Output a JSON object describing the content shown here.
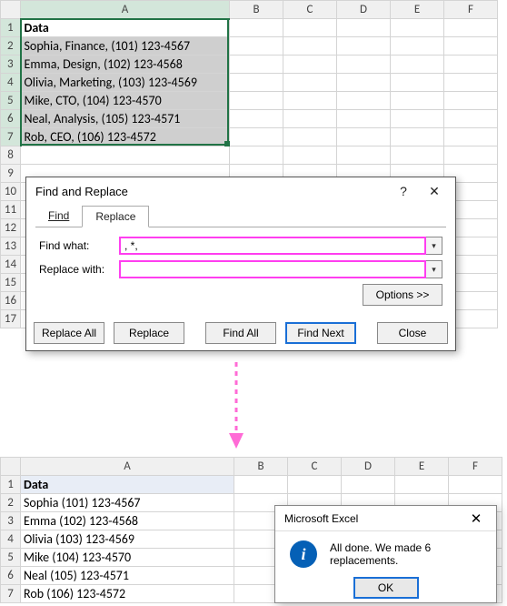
{
  "top_sheet": {
    "columns": [
      "A",
      "B",
      "C",
      "D",
      "E",
      "F"
    ],
    "rows": [
      "1",
      "2",
      "3",
      "4",
      "5",
      "6",
      "7",
      "8",
      "9",
      "10",
      "11",
      "12",
      "13",
      "14",
      "15",
      "16",
      "17"
    ],
    "header": "Data",
    "cells": [
      "Sophia, Finance, (101) 123-4567",
      "Emma, Design, (102) 123-4568",
      "Olivia, Marketing, (103) 123-4569",
      "Mike, CTO, (104) 123-4570",
      "Neal, Analysis, (105) 123-4571",
      "Rob, CEO, (106) 123-4572"
    ]
  },
  "bottom_sheet": {
    "columns": [
      "A",
      "B",
      "C",
      "D",
      "E",
      "F"
    ],
    "rows": [
      "1",
      "2",
      "3",
      "4",
      "5",
      "6",
      "7"
    ],
    "header": "Data",
    "cells": [
      "Sophia (101) 123-4567",
      "Emma (102) 123-4568",
      "Olivia (103) 123-4569",
      "Mike (104) 123-4570",
      "Neal (105) 123-4571",
      "Rob (106) 123-4572"
    ]
  },
  "dialog": {
    "title": "Find and Replace",
    "help": "?",
    "close": "✕",
    "tabs": {
      "find": "Find",
      "replace": "Replace"
    },
    "find_label": "Find what:",
    "replace_label": "Replace with:",
    "find_value": ", *,",
    "replace_value": "",
    "options": "Options >>",
    "buttons": {
      "replace_all": "Replace All",
      "replace": "Replace",
      "find_all": "Find All",
      "find_next": "Find Next",
      "close": "Close"
    }
  },
  "msgbox": {
    "title": "Microsoft Excel",
    "close": "✕",
    "text": "All done. We made 6 replacements.",
    "ok": "OK"
  }
}
